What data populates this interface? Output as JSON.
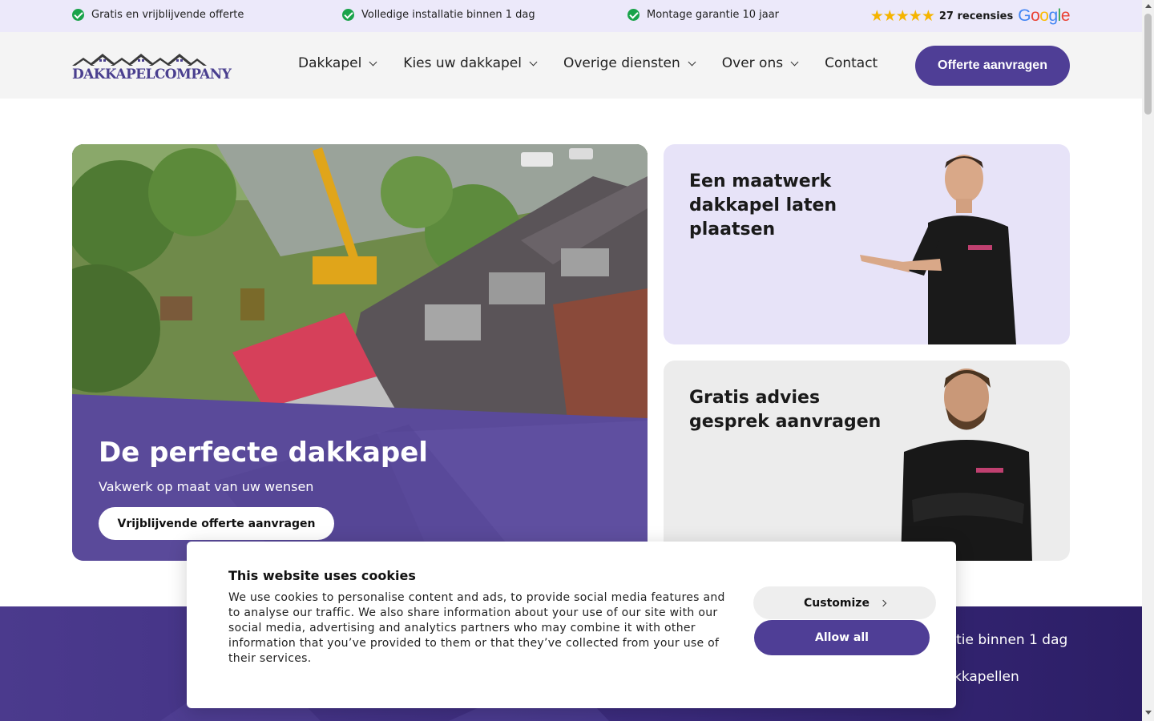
{
  "topbar": {
    "usps": [
      "Gratis en vrijblijvende offerte",
      "Volledige installatie binnen 1 dag",
      "Montage garantie 10 jaar"
    ],
    "stars": "★★★★★",
    "reviews": "27 recensies",
    "google": {
      "g": "G",
      "o1": "o",
      "o2": "o",
      "g2": "g",
      "l": "l",
      "e": "e"
    }
  },
  "header": {
    "logo_text": "DAKKAPELCOMPANY",
    "nav": [
      "Dakkapel",
      "Kies uw dakkapel",
      "Overige diensten",
      "Over ons",
      "Contact"
    ],
    "cta": "Offerte aanvragen"
  },
  "hero": {
    "title": "De perfecte dakkapel",
    "subtitle": "Vakwerk op maat van uw wensen",
    "button": "Vrijblijvende offerte aanvragen"
  },
  "cards": [
    {
      "title_lines": [
        "Een maatwerk",
        "dakkapel laten",
        "plaatsen"
      ]
    },
    {
      "title_lines": [
        "Gratis advies",
        "gesprek aanvragen"
      ]
    }
  ],
  "strip": {
    "line1": "latie binnen 1 dag",
    "line2": "kkapellen"
  },
  "cookie": {
    "title": "This website uses cookies",
    "body": "We use cookies to personalise content and ads, to provide social media features and to analyse our traffic. We also share information about your use of our site with our social media, advertising and analytics partners who may combine it with other information that you’ve provided to them or that they’ve collected from your use of their services.",
    "customize": "Customize",
    "allow_all": "Allow all"
  },
  "colors": {
    "brand": "#4f3e96",
    "topbar": "#ece9fa",
    "check": "#1aa34a",
    "star": "#f5b400"
  }
}
